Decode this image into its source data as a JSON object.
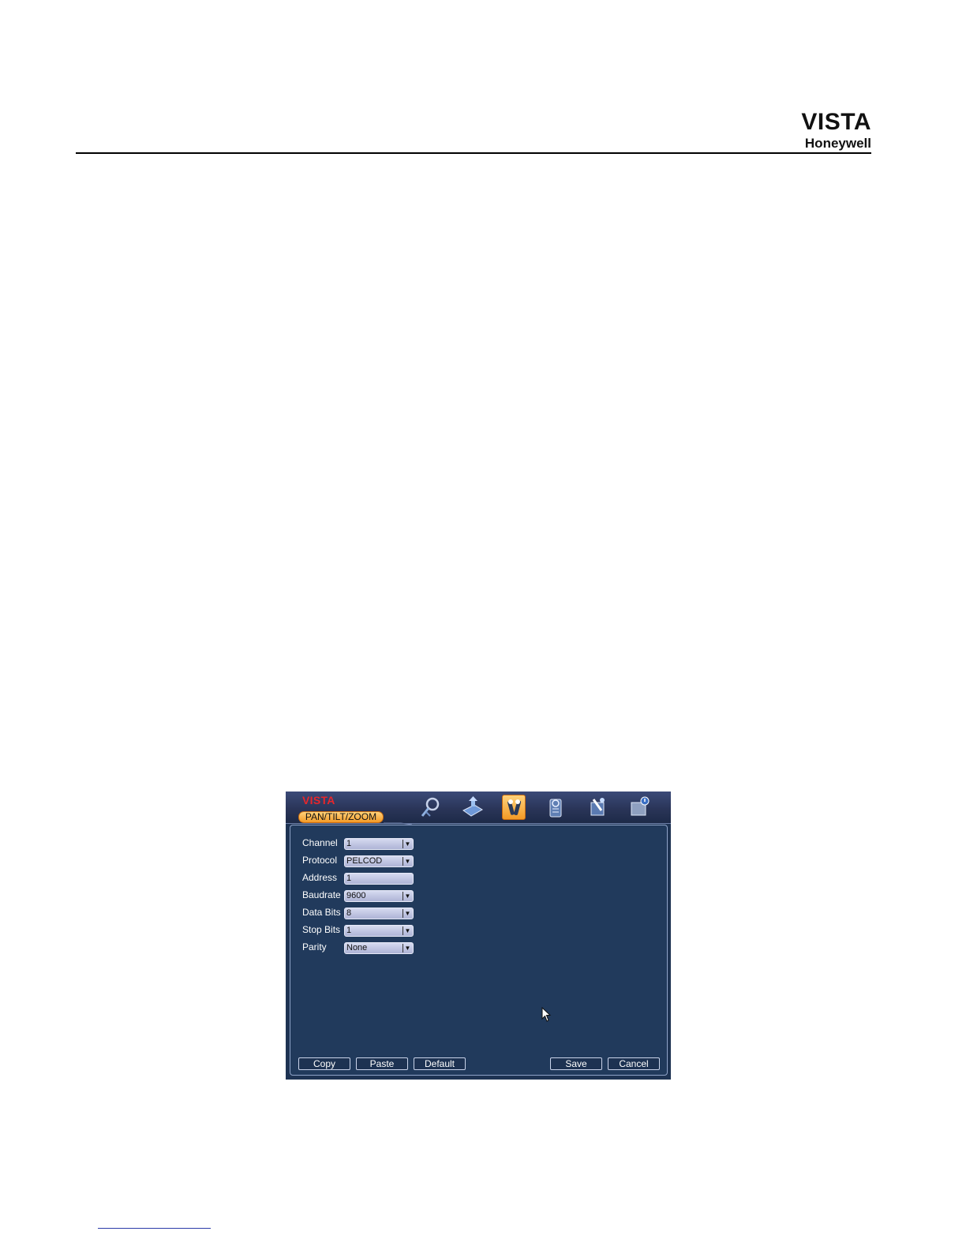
{
  "header": {
    "brand_vista": "VISTA",
    "brand_honeywell": "Honeywell"
  },
  "dvr": {
    "brand": "VISTA",
    "tab_label": "PAN/TILT/ZOOM",
    "toolbar_icons": [
      "search-icon",
      "backup-icon",
      "settings-tools-icon",
      "info-icon",
      "advanced-icon",
      "shutdown-icon"
    ],
    "active_icon": "settings-tools-icon",
    "fields": [
      {
        "label": "Channel",
        "value": "1",
        "type": "select"
      },
      {
        "label": "Protocol",
        "value": "PELCOD",
        "type": "select"
      },
      {
        "label": "Address",
        "value": "1",
        "type": "text"
      },
      {
        "label": "Baudrate",
        "value": "9600",
        "type": "select"
      },
      {
        "label": "Data Bits",
        "value": "8",
        "type": "select"
      },
      {
        "label": "Stop Bits",
        "value": "1",
        "type": "select"
      },
      {
        "label": "Parity",
        "value": "None",
        "type": "select"
      }
    ],
    "buttons": {
      "copy": "Copy",
      "paste": "Paste",
      "default": "Default",
      "save": "Save",
      "cancel": "Cancel"
    }
  },
  "colors": {
    "screen_bg": "#1e3353",
    "accent_orange": "#f39a26",
    "brand_red": "#e8262b"
  }
}
